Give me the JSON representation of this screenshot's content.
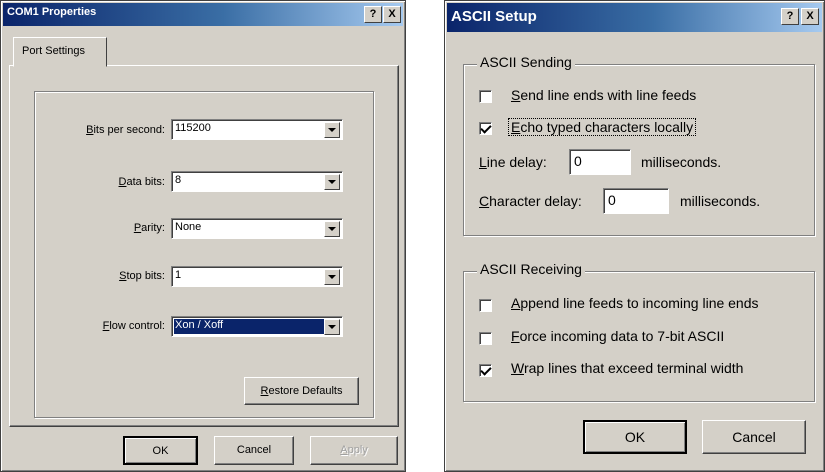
{
  "com_dialog": {
    "title": "COM1 Properties",
    "help_btn": "?",
    "close_btn": "X",
    "tab": "Port Settings",
    "fields": [
      {
        "label_u": "B",
        "label_rest": "its per second:",
        "value": "115200"
      },
      {
        "label_u": "D",
        "label_rest": "ata bits:",
        "value": "8"
      },
      {
        "label_u": "P",
        "label_rest": "arity:",
        "value": "None"
      },
      {
        "label_u": "S",
        "label_rest": "top bits:",
        "value": "1"
      },
      {
        "label_u": "F",
        "label_rest": "low control:",
        "value": "Xon / Xoff"
      }
    ],
    "restore_u": "R",
    "restore_rest": "estore Defaults",
    "ok": "OK",
    "cancel": "Cancel",
    "apply_u": "A",
    "apply_rest": "pply"
  },
  "ascii_dialog": {
    "title": "ASCII Setup",
    "help_btn": "?",
    "close_btn": "X",
    "sending_group": "ASCII Sending",
    "send_line_ends_u": "S",
    "send_line_ends_rest": "end line ends with line feeds",
    "send_line_ends_checked": false,
    "echo_u": "E",
    "echo_rest": "cho typed characters locally",
    "echo_checked": true,
    "line_delay_u": "L",
    "line_delay_rest": "ine delay:",
    "line_delay_value": "0",
    "line_delay_unit": "milliseconds.",
    "char_delay_u": "C",
    "char_delay_rest": "haracter delay:",
    "char_delay_value": "0",
    "char_delay_unit": "milliseconds.",
    "receiving_group": "ASCII Receiving",
    "append_u": "A",
    "append_rest": "ppend line feeds to incoming line ends",
    "append_checked": false,
    "force_u": "F",
    "force_rest": "orce incoming data to 7-bit ASCII",
    "force_checked": false,
    "wrap_u": "W",
    "wrap_rest": "rap lines that exceed terminal width",
    "wrap_checked": true,
    "ok": "OK",
    "cancel": "Cancel"
  }
}
